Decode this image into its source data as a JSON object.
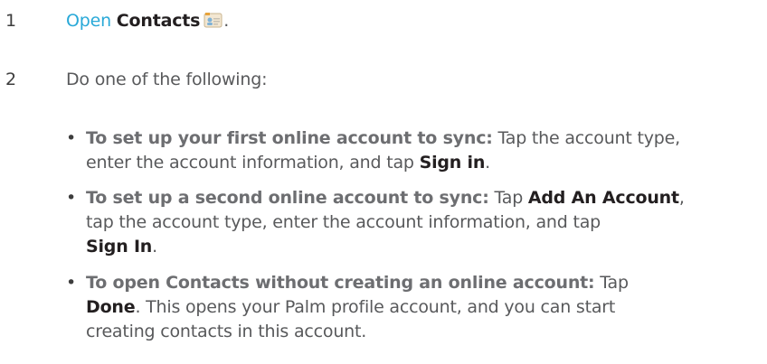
{
  "steps": [
    {
      "number": "1",
      "link": "Open",
      "app": "Contacts",
      "end": "."
    },
    {
      "number": "2",
      "text": "Do one of the following:"
    }
  ],
  "icon": "contacts-app-icon",
  "bullets": [
    {
      "marker": "•",
      "lead": "To set up your first online account to sync:",
      "t1": " Tap the account type,",
      "t2": "enter the account information, and tap ",
      "b1": "Sign in",
      "t3": "."
    },
    {
      "marker": "•",
      "lead": "To set up a second online account to sync:",
      "t1": " Tap ",
      "b1": "Add An Account",
      "t2": ",",
      "t3": "tap the account type, enter the account information, and tap",
      "b2": "Sign In",
      "t4": "."
    },
    {
      "marker": "•",
      "lead": "To open Contacts without creating an online account:",
      "t1": " Tap",
      "b1": "Done",
      "t2": ". This opens your Palm profile account, and you can start",
      "t3": "creating contacts in this account."
    }
  ],
  "colors": {
    "link": "#29a9d8",
    "text": "#58595b",
    "bold": "#231f20"
  }
}
